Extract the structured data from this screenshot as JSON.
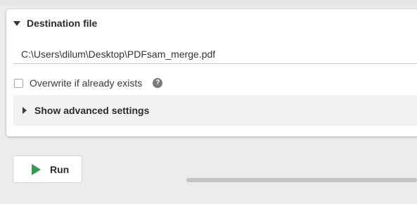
{
  "destination": {
    "title": "Destination file",
    "path_value": "C:\\Users\\dilum\\Desktop\\PDFsam_merge.pdf",
    "overwrite_label": "Overwrite if already exists",
    "overwrite_checked": false,
    "help_icon": "question-mark-icon",
    "help_glyph": "?",
    "advanced_label": "Show advanced settings"
  },
  "footer": {
    "run_label": "Run",
    "run_icon": "play-icon",
    "progress": 0
  },
  "colors": {
    "run_icon": "#2e9e4e",
    "background": "#ececec",
    "panel": "#ffffff"
  }
}
